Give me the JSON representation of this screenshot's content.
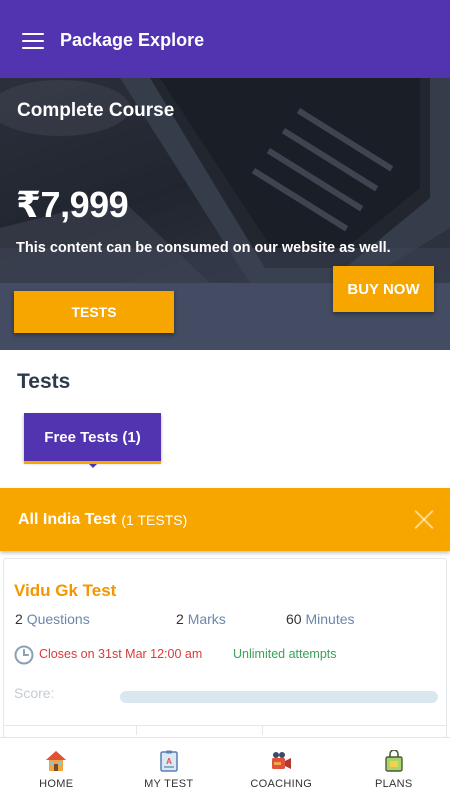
{
  "app_bar": {
    "menu_icon": "hamburger-menu-icon",
    "title": "Package Explore",
    "background": "#5233b0"
  },
  "hero": {
    "course_title": "Complete Course",
    "price": "₹7,999",
    "note": "This content can be consumed on our website as well.",
    "buy_label": "BUY NOW",
    "tests_label": "TESTS",
    "accent": "#f7a600"
  },
  "tests_section": {
    "heading": "Tests",
    "chip_label": "Free Tests (1)"
  },
  "group": {
    "name": "All India Test",
    "count": "(1 TESTS)",
    "close_icon": "close-icon"
  },
  "test_card": {
    "name": "Vidu Gk Test",
    "questions": {
      "value": "2",
      "label": "Questions"
    },
    "marks": {
      "value": "2",
      "label": "Marks"
    },
    "minutes": {
      "value": "60",
      "label": "Minutes"
    },
    "clock_icon": "clock-icon",
    "closes": "Closes on 31st Mar 12:00 am",
    "attempts": "Unlimited attempts",
    "score_label": "Score:",
    "score_progress": 0
  },
  "bottom_nav": {
    "items": [
      {
        "label": "HOME",
        "icon": "home-icon"
      },
      {
        "label": "MY TEST",
        "icon": "test-sheet-icon"
      },
      {
        "label": "COACHING",
        "icon": "coaching-video-icon"
      },
      {
        "label": "PLANS",
        "icon": "plans-bag-icon"
      }
    ]
  }
}
